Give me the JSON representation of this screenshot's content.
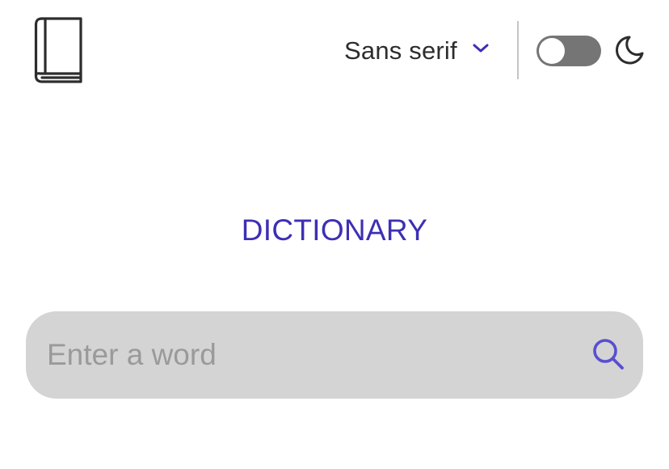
{
  "header": {
    "logo_icon": "book-icon",
    "font_selector": {
      "selected": "Sans serif",
      "icon": "chevron-down-icon"
    },
    "theme_toggle": {
      "state": "off",
      "icon": "moon-icon"
    }
  },
  "main": {
    "title": "DICTIONARY",
    "search": {
      "placeholder": "Enter a word",
      "value": "",
      "icon": "search-icon"
    }
  },
  "colors": {
    "accent": "#3d2fb5",
    "text": "#2d2d2d",
    "toggle_track": "#757575",
    "search_background": "#d4d4d4",
    "placeholder": "#9a9a9a"
  }
}
